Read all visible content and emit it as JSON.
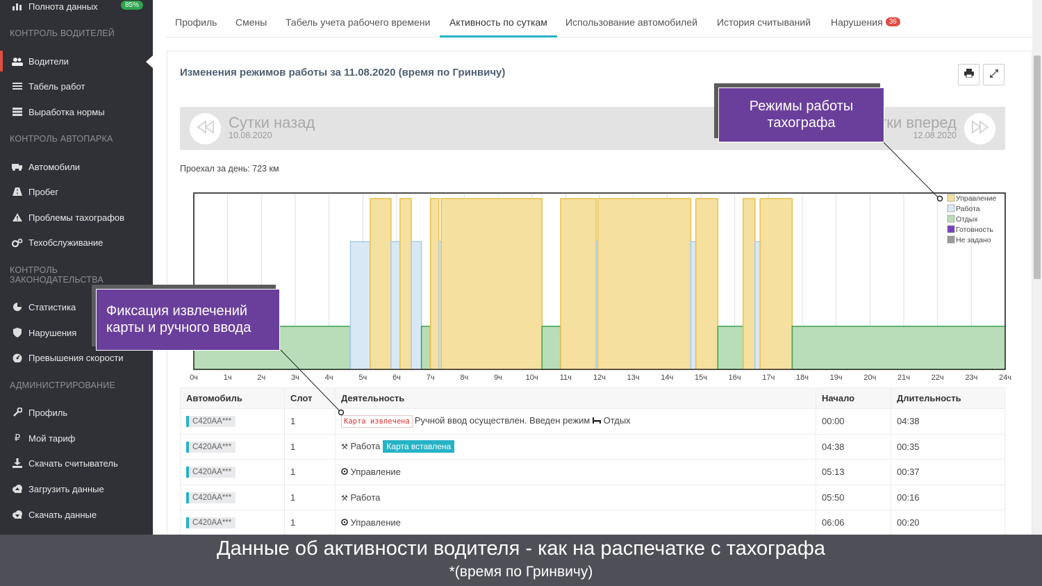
{
  "sidebar": {
    "top_item": {
      "label": "Полнота данных",
      "badge": "85%"
    },
    "sections": [
      {
        "title": "КОНТРОЛЬ ВОДИТЕЛЕЙ"
      },
      {
        "title": "КОНТРОЛЬ АВТОПАРКА"
      },
      {
        "title": "КОНТРОЛЬ ЗАКОНОДАТЕЛЬСТВА"
      },
      {
        "title": "АДМИНИСТРИРОВАНИЕ"
      }
    ],
    "items": [
      {
        "label": "Водители",
        "icon": "users-icon"
      },
      {
        "label": "Табель работ",
        "icon": "list-icon"
      },
      {
        "label": "Выработка нормы",
        "icon": "server-icon"
      },
      {
        "label": "Автомобили",
        "icon": "truck-icon"
      },
      {
        "label": "Пробег",
        "icon": "road-icon"
      },
      {
        "label": "Проблемы тахографов",
        "icon": "warning-icon"
      },
      {
        "label": "Техобслуживание",
        "icon": "gears-icon"
      },
      {
        "label": "Статистика",
        "icon": "pie-chart-icon"
      },
      {
        "label": "Нарушения",
        "icon": "shield-icon"
      },
      {
        "label": "Превышения скорости",
        "icon": "dashboard-icon"
      },
      {
        "label": "Профиль",
        "icon": "wrench-icon"
      },
      {
        "label": "Мой тариф",
        "icon": "ruble-icon"
      },
      {
        "label": "Скачать считыватель",
        "icon": "download-icon"
      },
      {
        "label": "Загрузить данные",
        "icon": "cloud-upload-icon"
      },
      {
        "label": "Скачать данные",
        "icon": "cloud-download-icon"
      }
    ]
  },
  "tabs": [
    {
      "label": "Профиль"
    },
    {
      "label": "Смены"
    },
    {
      "label": "Табель учета рабочего времени"
    },
    {
      "label": "Активность по суткам"
    },
    {
      "label": "Использование автомобилей"
    },
    {
      "label": "История считываний"
    },
    {
      "label": "Нарушения",
      "badge": "36"
    }
  ],
  "panel": {
    "title": "Изменения режимов работы за 11.08.2020 (время по Гринвичу)",
    "prev": {
      "label": "Сутки назад",
      "date": "10.08.2020"
    },
    "next": {
      "label": "Сутки вперед",
      "date": "12.08.2020"
    },
    "distance": "Проехал за день: 723 км"
  },
  "chart_data": {
    "type": "area",
    "x_ticks": [
      "0ч",
      "1ч",
      "2ч",
      "3ч",
      "4ч",
      "5ч",
      "6ч",
      "7ч",
      "8ч",
      "9ч",
      "10ч",
      "11ч",
      "12ч",
      "13ч",
      "14ч",
      "15ч",
      "16ч",
      "17ч",
      "18ч",
      "19ч",
      "20ч",
      "21ч",
      "22ч",
      "23ч",
      "24ч"
    ],
    "xlim": [
      0,
      24
    ],
    "legend": [
      "Управление",
      "Работа",
      "Отдых",
      "Готовность",
      "Не задано"
    ],
    "legend_position": "top-right",
    "colors": {
      "Управление": "#f5e0a0",
      "Работа": "#d8e8f5",
      "Отдых": "#b9ddb9",
      "Готовность": "#7a3fc0",
      "Не задано": "#9a9a9a"
    },
    "segments": [
      {
        "mode": "Отдых",
        "start": 0.0,
        "end": 4.633
      },
      {
        "mode": "Работа",
        "start": 4.633,
        "end": 5.217
      },
      {
        "mode": "Управление",
        "start": 5.217,
        "end": 5.833
      },
      {
        "mode": "Работа",
        "start": 5.833,
        "end": 6.1
      },
      {
        "mode": "Управление",
        "start": 6.1,
        "end": 6.433
      },
      {
        "mode": "Работа",
        "start": 6.433,
        "end": 6.733
      },
      {
        "mode": "Отдых",
        "start": 6.733,
        "end": 7.0
      },
      {
        "mode": "Управление",
        "start": 7.0,
        "end": 7.25
      },
      {
        "mode": "Работа",
        "start": 7.25,
        "end": 7.317
      },
      {
        "mode": "Управление",
        "start": 7.317,
        "end": 10.3
      },
      {
        "mode": "Отдых",
        "start": 10.3,
        "end": 10.85
      },
      {
        "mode": "Управление",
        "start": 10.85,
        "end": 11.9
      },
      {
        "mode": "Работа",
        "start": 11.9,
        "end": 11.95
      },
      {
        "mode": "Управление",
        "start": 11.95,
        "end": 14.7
      },
      {
        "mode": "Работа",
        "start": 14.7,
        "end": 14.85
      },
      {
        "mode": "Управление",
        "start": 14.85,
        "end": 15.5
      },
      {
        "mode": "Отдых",
        "start": 15.5,
        "end": 16.25
      },
      {
        "mode": "Управление",
        "start": 16.25,
        "end": 16.6
      },
      {
        "mode": "Работа",
        "start": 16.6,
        "end": 16.75
      },
      {
        "mode": "Управление",
        "start": 16.75,
        "end": 17.7
      },
      {
        "mode": "Отдых",
        "start": 17.7,
        "end": 24.0
      }
    ]
  },
  "table": {
    "headers": [
      "Автомобиль",
      "Слот",
      "Деятельность",
      "Начало",
      "Длительность"
    ],
    "rows": [
      {
        "car": "C420AA***",
        "slot": "1",
        "tag": "Карта извлечена",
        "activity": "Ручной ввод осуществлен. Введен режим",
        "mode": "Отдых",
        "start": "00:00",
        "duration": "04:38"
      },
      {
        "car": "C420AA***",
        "slot": "1",
        "activity": "Работа",
        "tag2": "Карта вставлена",
        "start": "04:38",
        "duration": "00:35"
      },
      {
        "car": "C420AA***",
        "slot": "1",
        "activity": "Управление",
        "start": "05:13",
        "duration": "00:37"
      },
      {
        "car": "C420AA***",
        "slot": "1",
        "activity": "Работа",
        "start": "05:50",
        "duration": "00:16"
      },
      {
        "car": "C420AA***",
        "slot": "1",
        "activity": "Управление",
        "start": "06:06",
        "duration": "00:20"
      }
    ]
  },
  "callouts": {
    "modes": "Режимы работы тахографа",
    "card": "Фиксация извлечений карты и ручного ввода"
  },
  "caption": {
    "line1": "Данные об активности водителя - как на распечатке с тахографа",
    "line2": "*(время по Гринвичу)"
  }
}
